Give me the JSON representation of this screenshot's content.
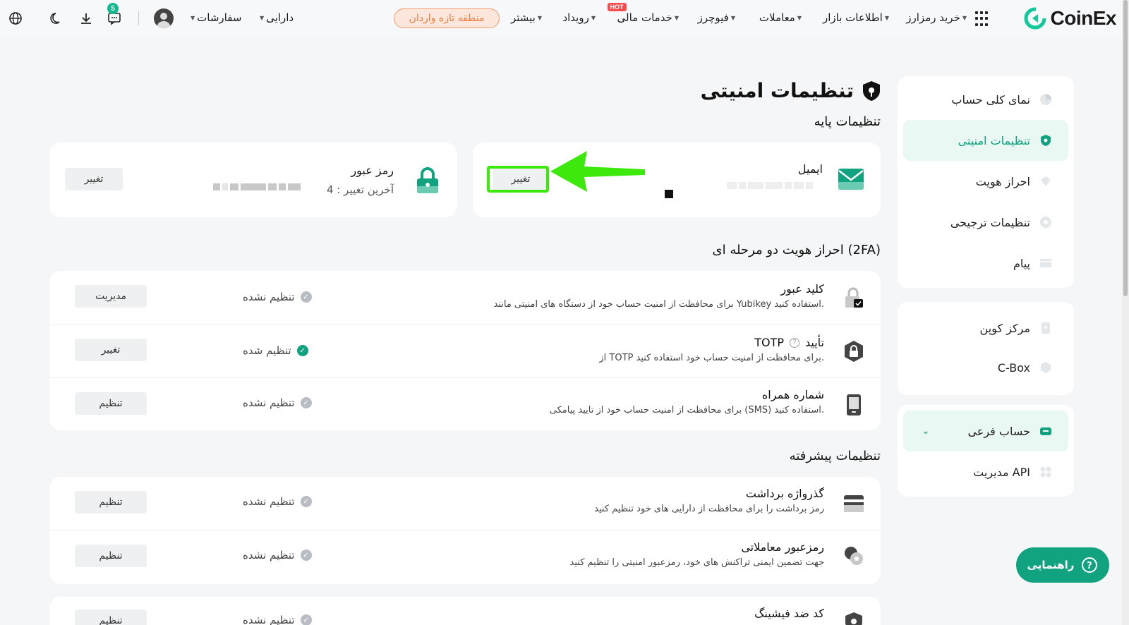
{
  "nav": {
    "logo": "CoinEx",
    "items": [
      {
        "label": "خرید رمزارز"
      },
      {
        "label": "اطلاعات بازار"
      },
      {
        "label": "معاملات"
      },
      {
        "label": "فیوچرز"
      },
      {
        "label": "خدمات مالی",
        "badge": "HOT"
      },
      {
        "label": "رویداد"
      },
      {
        "label": "بیشتر"
      }
    ],
    "new_zone": "منطقه تازه واردان",
    "assets": "دارایی",
    "orders": "سفارشات",
    "message_count": "5"
  },
  "sidebar": {
    "group1": [
      {
        "label": "نمای کلی حساب",
        "icon": "pie-chart-icon"
      },
      {
        "label": "تنظیمات امنیتی",
        "icon": "shield-icon",
        "active": true
      },
      {
        "label": "احراز هویت",
        "icon": "id-icon"
      },
      {
        "label": "تنظیمات ترجیحی",
        "icon": "gear-icon"
      },
      {
        "label": "پیام",
        "icon": "message-icon"
      }
    ],
    "group2": [
      {
        "label": "مرکز کوپن",
        "icon": "coupon-icon"
      },
      {
        "label": "C-Box",
        "icon": "box-icon"
      }
    ],
    "group3": [
      {
        "label": "حساب فرعی",
        "icon": "subaccount-icon"
      },
      {
        "label": "مدیریت API",
        "icon": "api-icon"
      }
    ]
  },
  "page": {
    "title": "تنظیمات امنیتی",
    "basic_heading": "تنظیمات پایه",
    "email": {
      "label": "ایمیل",
      "button": "تغییر"
    },
    "password": {
      "label": "رمز عبور",
      "last_change": "آخرین تغییر :",
      "last_change_value": "4",
      "button": "تغییر"
    },
    "twofa_heading": "احراز هویت دو مرحله ای (2FA)",
    "twofa_rows": [
      {
        "title": "کلید عبور",
        "desc": "برای محافظت از امنیت حساب خود از دستگاه های امنیتی مانند Yubikey استفاده کنید.",
        "status": "تنظیم نشده",
        "status_ok": false,
        "button": "مدیریت"
      },
      {
        "title": "تأیید",
        "title_extra": "TOTP",
        "desc": "از TOTP برای محافظت از امنیت حساب خود استفاده کنید.",
        "status": "تنظیم شده",
        "status_ok": true,
        "button": "تغییر"
      },
      {
        "title": "شماره همراه",
        "desc": "برای محافظت از امنیت حساب خود از تایید پیامکی (SMS) استفاده کنید.",
        "status": "تنظیم نشده",
        "status_ok": false,
        "button": "تنظیم"
      }
    ],
    "advanced_heading": "تنظیمات پیشرفته",
    "advanced_rows": [
      {
        "title": "گذرواژه برداشت",
        "desc": "رمز برداشت را برای محافظت از دارایی های خود تنظیم کنید",
        "status": "تنظیم نشده",
        "button": "تنظیم"
      },
      {
        "title": "رمزعبور معاملاتی",
        "desc": "جهت تضمین ایمنی تراکنش های خود، رمزعبور امنیتی را تنظیم کنید",
        "status": "تنظیم نشده",
        "button": "تنظیم"
      },
      {
        "title": "کد ضد فیشینگ",
        "status": "تنظیم نشده",
        "button": "تنظیم"
      }
    ]
  },
  "help_button": "راهنمایی",
  "colors": {
    "accent": "#11a37f",
    "annotation": "#3de80c",
    "new_zone": "#f27b3a"
  }
}
